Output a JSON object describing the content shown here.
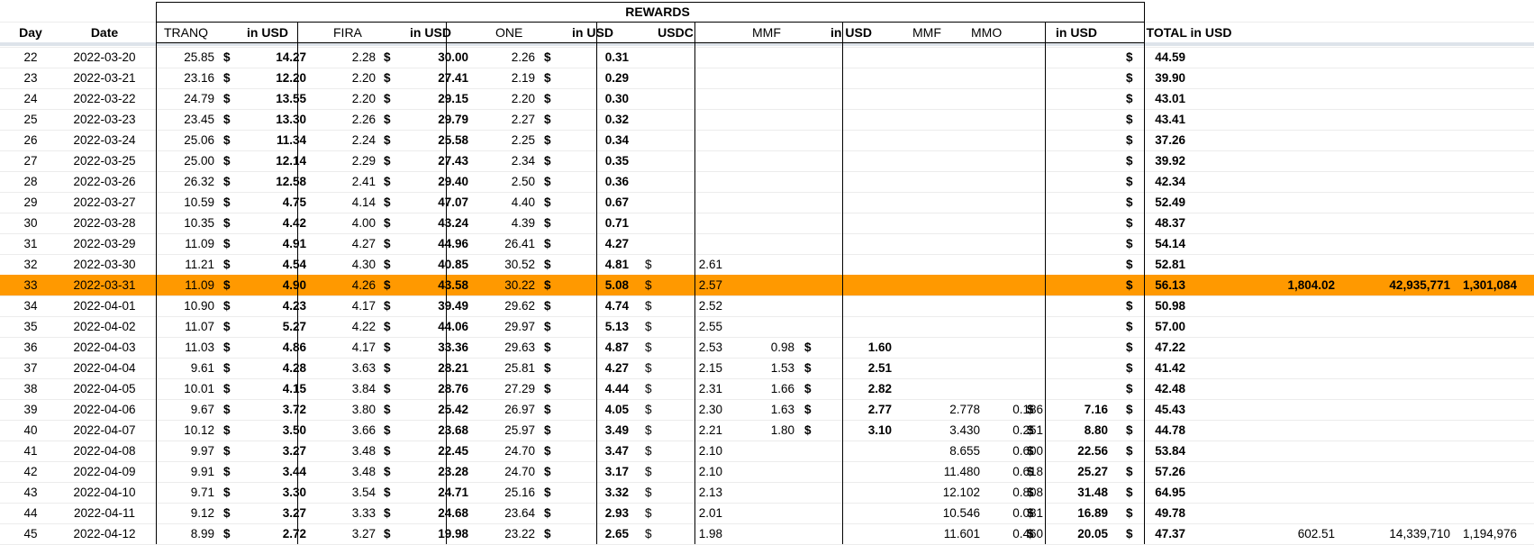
{
  "sheet": {
    "group_title": "REWARDS",
    "headers": {
      "day": "Day",
      "date": "Date",
      "tranq": "TRANQ",
      "tranq_usd": "in USD",
      "fira": "FIRA",
      "fira_usd": "in USD",
      "one": "ONE",
      "one_usd": "in USD",
      "usdc": "USDC",
      "mmf1": "MMF",
      "mmf1_usd": "in USD",
      "mmf2": "MMF",
      "mmo": "MMO",
      "mm2_usd": "in USD",
      "total": "TOTAL in USD"
    },
    "currency_symbol": "$",
    "highlight_color": "#ff9900",
    "highlighted_day": "33",
    "rows": [
      {
        "day": "22",
        "date": "2022-03-20",
        "tranq": "25.85",
        "tranq_usd": "14.27",
        "fira": "2.28",
        "fira_usd": "30.00",
        "one": "2.26",
        "one_usd": "0.31",
        "usdc": "",
        "mmf1": "",
        "mmf1_usd": "",
        "mmf2": "",
        "mmo": "",
        "mm2_usd": "",
        "total": "44.59",
        "x1": "",
        "x2": "",
        "x3": ""
      },
      {
        "day": "23",
        "date": "2022-03-21",
        "tranq": "23.16",
        "tranq_usd": "12.20",
        "fira": "2.20",
        "fira_usd": "27.41",
        "one": "2.19",
        "one_usd": "0.29",
        "usdc": "",
        "mmf1": "",
        "mmf1_usd": "",
        "mmf2": "",
        "mmo": "",
        "mm2_usd": "",
        "total": "39.90",
        "x1": "",
        "x2": "",
        "x3": ""
      },
      {
        "day": "24",
        "date": "2022-03-22",
        "tranq": "24.79",
        "tranq_usd": "13.55",
        "fira": "2.20",
        "fira_usd": "29.15",
        "one": "2.20",
        "one_usd": "0.30",
        "usdc": "",
        "mmf1": "",
        "mmf1_usd": "",
        "mmf2": "",
        "mmo": "",
        "mm2_usd": "",
        "total": "43.01",
        "x1": "",
        "x2": "",
        "x3": ""
      },
      {
        "day": "25",
        "date": "2022-03-23",
        "tranq": "23.45",
        "tranq_usd": "13.30",
        "fira": "2.26",
        "fira_usd": "29.79",
        "one": "2.27",
        "one_usd": "0.32",
        "usdc": "",
        "mmf1": "",
        "mmf1_usd": "",
        "mmf2": "",
        "mmo": "",
        "mm2_usd": "",
        "total": "43.41",
        "x1": "",
        "x2": "",
        "x3": ""
      },
      {
        "day": "26",
        "date": "2022-03-24",
        "tranq": "25.06",
        "tranq_usd": "11.34",
        "fira": "2.24",
        "fira_usd": "25.58",
        "one": "2.25",
        "one_usd": "0.34",
        "usdc": "",
        "mmf1": "",
        "mmf1_usd": "",
        "mmf2": "",
        "mmo": "",
        "mm2_usd": "",
        "total": "37.26",
        "x1": "",
        "x2": "",
        "x3": ""
      },
      {
        "day": "27",
        "date": "2022-03-25",
        "tranq": "25.00",
        "tranq_usd": "12.14",
        "fira": "2.29",
        "fira_usd": "27.43",
        "one": "2.34",
        "one_usd": "0.35",
        "usdc": "",
        "mmf1": "",
        "mmf1_usd": "",
        "mmf2": "",
        "mmo": "",
        "mm2_usd": "",
        "total": "39.92",
        "x1": "",
        "x2": "",
        "x3": ""
      },
      {
        "day": "28",
        "date": "2022-03-26",
        "tranq": "26.32",
        "tranq_usd": "12.58",
        "fira": "2.41",
        "fira_usd": "29.40",
        "one": "2.50",
        "one_usd": "0.36",
        "usdc": "",
        "mmf1": "",
        "mmf1_usd": "",
        "mmf2": "",
        "mmo": "",
        "mm2_usd": "",
        "total": "42.34",
        "x1": "",
        "x2": "",
        "x3": ""
      },
      {
        "day": "29",
        "date": "2022-03-27",
        "tranq": "10.59",
        "tranq_usd": "4.75",
        "fira": "4.14",
        "fira_usd": "47.07",
        "one": "4.40",
        "one_usd": "0.67",
        "usdc": "",
        "mmf1": "",
        "mmf1_usd": "",
        "mmf2": "",
        "mmo": "",
        "mm2_usd": "",
        "total": "52.49",
        "x1": "",
        "x2": "",
        "x3": ""
      },
      {
        "day": "30",
        "date": "2022-03-28",
        "tranq": "10.35",
        "tranq_usd": "4.42",
        "fira": "4.00",
        "fira_usd": "43.24",
        "one": "4.39",
        "one_usd": "0.71",
        "usdc": "",
        "mmf1": "",
        "mmf1_usd": "",
        "mmf2": "",
        "mmo": "",
        "mm2_usd": "",
        "total": "48.37",
        "x1": "",
        "x2": "",
        "x3": ""
      },
      {
        "day": "31",
        "date": "2022-03-29",
        "tranq": "11.09",
        "tranq_usd": "4.91",
        "fira": "4.27",
        "fira_usd": "44.96",
        "one": "26.41",
        "one_usd": "4.27",
        "usdc": "",
        "mmf1": "",
        "mmf1_usd": "",
        "mmf2": "",
        "mmo": "",
        "mm2_usd": "",
        "total": "54.14",
        "x1": "",
        "x2": "",
        "x3": ""
      },
      {
        "day": "32",
        "date": "2022-03-30",
        "tranq": "11.21",
        "tranq_usd": "4.54",
        "fira": "4.30",
        "fira_usd": "40.85",
        "one": "30.52",
        "one_usd": "4.81",
        "usdc": "2.61",
        "mmf1": "",
        "mmf1_usd": "",
        "mmf2": "",
        "mmo": "",
        "mm2_usd": "",
        "total": "52.81",
        "x1": "",
        "x2": "",
        "x3": ""
      },
      {
        "day": "33",
        "date": "2022-03-31",
        "tranq": "11.09",
        "tranq_usd": "4.90",
        "fira": "4.26",
        "fira_usd": "43.58",
        "one": "30.22",
        "one_usd": "5.08",
        "usdc": "2.57",
        "mmf1": "",
        "mmf1_usd": "",
        "mmf2": "",
        "mmo": "",
        "mm2_usd": "",
        "total": "56.13",
        "x1": "1,804.02",
        "x2": "42,935,771",
        "x3": "1,301,084"
      },
      {
        "day": "34",
        "date": "2022-04-01",
        "tranq": "10.90",
        "tranq_usd": "4.23",
        "fira": "4.17",
        "fira_usd": "39.49",
        "one": "29.62",
        "one_usd": "4.74",
        "usdc": "2.52",
        "mmf1": "",
        "mmf1_usd": "",
        "mmf2": "",
        "mmo": "",
        "mm2_usd": "",
        "total": "50.98",
        "x1": "",
        "x2": "",
        "x3": ""
      },
      {
        "day": "35",
        "date": "2022-04-02",
        "tranq": "11.07",
        "tranq_usd": "5.27",
        "fira": "4.22",
        "fira_usd": "44.06",
        "one": "29.97",
        "one_usd": "5.13",
        "usdc": "2.55",
        "mmf1": "",
        "mmf1_usd": "",
        "mmf2": "",
        "mmo": "",
        "mm2_usd": "",
        "total": "57.00",
        "x1": "",
        "x2": "",
        "x3": ""
      },
      {
        "day": "36",
        "date": "2022-04-03",
        "tranq": "11.03",
        "tranq_usd": "4.86",
        "fira": "4.17",
        "fira_usd": "33.36",
        "one": "29.63",
        "one_usd": "4.87",
        "usdc": "2.53",
        "mmf1": "0.98",
        "mmf1_usd": "1.60",
        "mmf2": "",
        "mmo": "",
        "mm2_usd": "",
        "total": "47.22",
        "x1": "",
        "x2": "",
        "x3": ""
      },
      {
        "day": "37",
        "date": "2022-04-04",
        "tranq": "9.61",
        "tranq_usd": "4.28",
        "fira": "3.63",
        "fira_usd": "28.21",
        "one": "25.81",
        "one_usd": "4.27",
        "usdc": "2.15",
        "mmf1": "1.53",
        "mmf1_usd": "2.51",
        "mmf2": "",
        "mmo": "",
        "mm2_usd": "",
        "total": "41.42",
        "x1": "",
        "x2": "",
        "x3": ""
      },
      {
        "day": "38",
        "date": "2022-04-05",
        "tranq": "10.01",
        "tranq_usd": "4.15",
        "fira": "3.84",
        "fira_usd": "28.76",
        "one": "27.29",
        "one_usd": "4.44",
        "usdc": "2.31",
        "mmf1": "1.66",
        "mmf1_usd": "2.82",
        "mmf2": "",
        "mmo": "",
        "mm2_usd": "",
        "total": "42.48",
        "x1": "",
        "x2": "",
        "x3": ""
      },
      {
        "day": "39",
        "date": "2022-04-06",
        "tranq": "9.67",
        "tranq_usd": "3.72",
        "fira": "3.80",
        "fira_usd": "25.42",
        "one": "26.97",
        "one_usd": "4.05",
        "usdc": "2.30",
        "mmf1": "1.63",
        "mmf1_usd": "2.77",
        "mmf2": "2.778",
        "mmo": "0.186",
        "mm2_usd": "7.16",
        "total": "45.43",
        "x1": "",
        "x2": "",
        "x3": ""
      },
      {
        "day": "40",
        "date": "2022-04-07",
        "tranq": "10.12",
        "tranq_usd": "3.50",
        "fira": "3.66",
        "fira_usd": "23.68",
        "one": "25.97",
        "one_usd": "3.49",
        "usdc": "2.21",
        "mmf1": "1.80",
        "mmf1_usd": "3.10",
        "mmf2": "3.430",
        "mmo": "0.251",
        "mm2_usd": "8.80",
        "total": "44.78",
        "x1": "",
        "x2": "",
        "x3": ""
      },
      {
        "day": "41",
        "date": "2022-04-08",
        "tranq": "9.97",
        "tranq_usd": "3.27",
        "fira": "3.48",
        "fira_usd": "22.45",
        "one": "24.70",
        "one_usd": "3.47",
        "usdc": "2.10",
        "mmf1": "",
        "mmf1_usd": "",
        "mmf2": "8.655",
        "mmo": "0.600",
        "mm2_usd": "22.56",
        "total": "53.84",
        "x1": "",
        "x2": "",
        "x3": ""
      },
      {
        "day": "42",
        "date": "2022-04-09",
        "tranq": "9.91",
        "tranq_usd": "3.44",
        "fira": "3.48",
        "fira_usd": "23.28",
        "one": "24.70",
        "one_usd": "3.17",
        "usdc": "2.10",
        "mmf1": "",
        "mmf1_usd": "",
        "mmf2": "11.480",
        "mmo": "0.618",
        "mm2_usd": "25.27",
        "total": "57.26",
        "x1": "",
        "x2": "",
        "x3": ""
      },
      {
        "day": "43",
        "date": "2022-04-10",
        "tranq": "9.71",
        "tranq_usd": "3.30",
        "fira": "3.54",
        "fira_usd": "24.71",
        "one": "25.16",
        "one_usd": "3.32",
        "usdc": "2.13",
        "mmf1": "",
        "mmf1_usd": "",
        "mmf2": "12.102",
        "mmo": "0.808",
        "mm2_usd": "31.48",
        "total": "64.95",
        "x1": "",
        "x2": "",
        "x3": ""
      },
      {
        "day": "44",
        "date": "2022-04-11",
        "tranq": "9.12",
        "tranq_usd": "3.27",
        "fira": "3.33",
        "fira_usd": "24.68",
        "one": "23.64",
        "one_usd": "2.93",
        "usdc": "2.01",
        "mmf1": "",
        "mmf1_usd": "",
        "mmf2": "10.546",
        "mmo": "0.081",
        "mm2_usd": "16.89",
        "total": "49.78",
        "x1": "",
        "x2": "",
        "x3": ""
      },
      {
        "day": "45",
        "date": "2022-04-12",
        "tranq": "8.99",
        "tranq_usd": "2.72",
        "fira": "3.27",
        "fira_usd": "19.98",
        "one": "23.22",
        "one_usd": "2.65",
        "usdc": "1.98",
        "mmf1": "",
        "mmf1_usd": "",
        "mmf2": "11.601",
        "mmo": "0.460",
        "mm2_usd": "20.05",
        "total": "47.37",
        "x1": "602.51",
        "x2": "14,339,710",
        "x3": "1,194,976"
      }
    ]
  }
}
